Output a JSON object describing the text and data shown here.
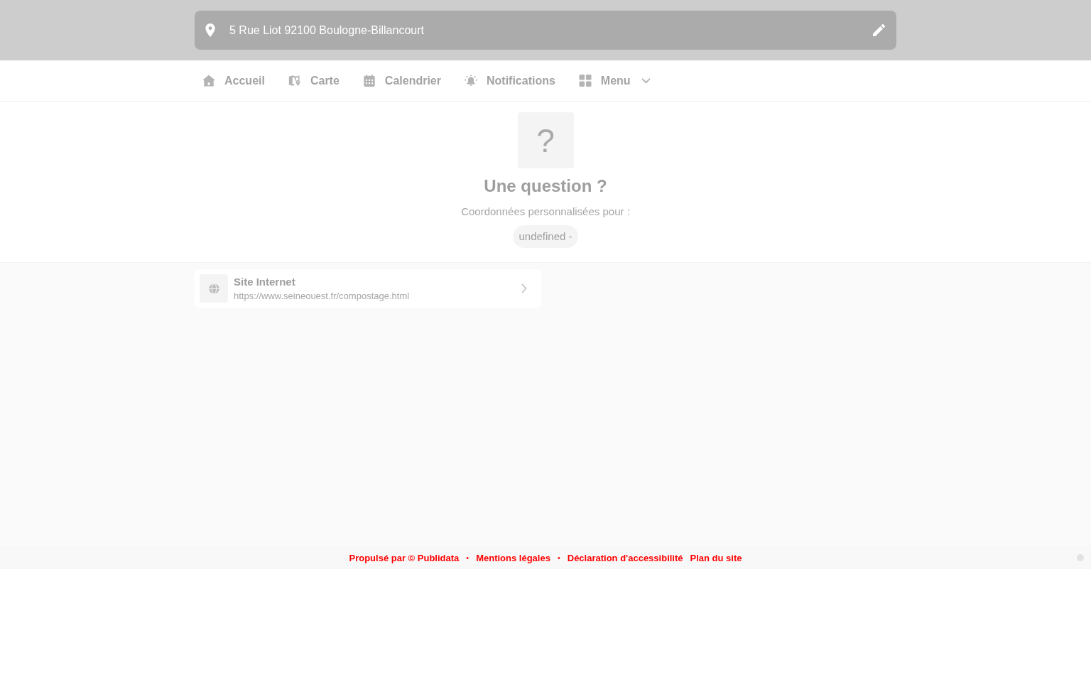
{
  "address_bar": {
    "address": "5 Rue Liot 92100 Boulogne-Billancourt"
  },
  "nav": {
    "items": [
      {
        "label": "Accueil",
        "kind": "link"
      },
      {
        "label": "Carte",
        "kind": "link"
      },
      {
        "label": "Calendrier",
        "kind": "link"
      },
      {
        "label": "Notifications",
        "kind": "link"
      },
      {
        "label": "Menu",
        "kind": "dropdown"
      }
    ]
  },
  "contact": {
    "icon_glyph": "?",
    "title": "Une question ?",
    "subtitle": "Coordonnées personnalisées pour :",
    "tag": "undefined -"
  },
  "links": [
    {
      "title": "Site Internet",
      "url": "https://www.seineouest.fr/compostage.html"
    }
  ],
  "footer": {
    "items": [
      {
        "kind": "link",
        "text": "Propulsé par © Publidata"
      },
      {
        "kind": "separator",
        "text": "•"
      },
      {
        "kind": "link",
        "text": "Mentions légales"
      },
      {
        "kind": "separator",
        "text": "•"
      },
      {
        "kind": "link",
        "text": "Déclaration d'accessibilité"
      },
      {
        "kind": "link",
        "text": "Plan du site"
      }
    ]
  }
}
